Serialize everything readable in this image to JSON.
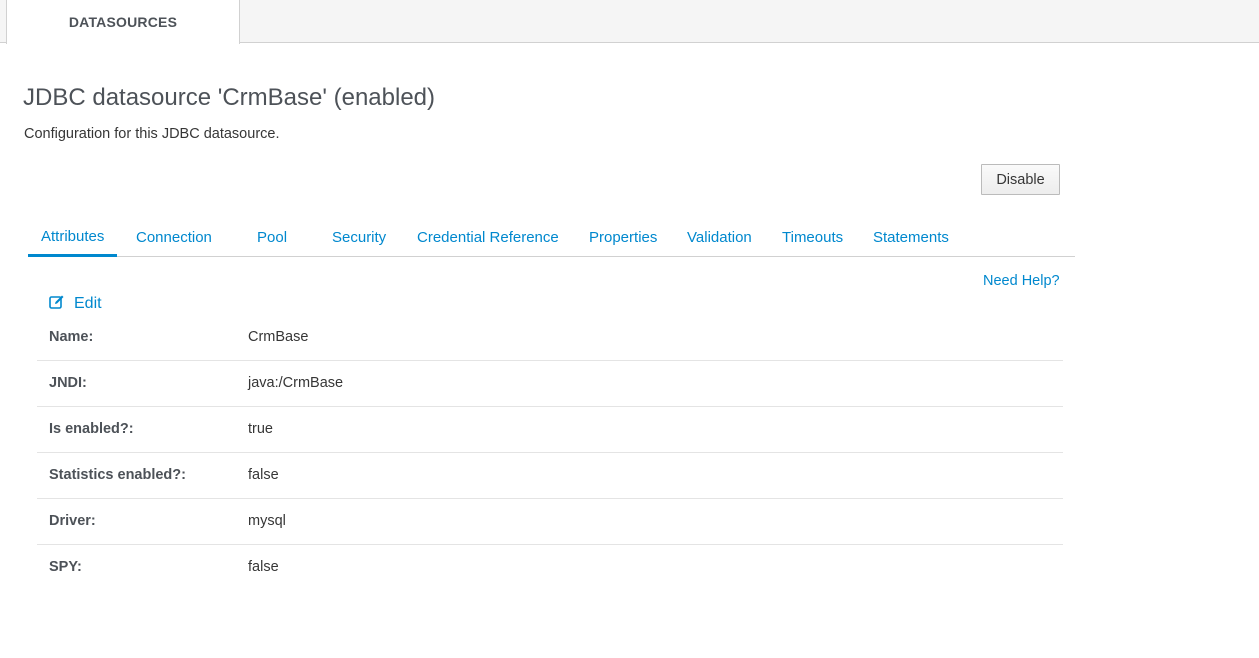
{
  "top_tab": "DATASOURCES",
  "page_title": "JDBC datasource 'CrmBase' (enabled)",
  "page_description": "Configuration for this JDBC datasource.",
  "disable_button": "Disable",
  "tabs": [
    {
      "label": "Attributes"
    },
    {
      "label": "Connection"
    },
    {
      "label": "Pool"
    },
    {
      "label": "Security"
    },
    {
      "label": "Credential Reference"
    },
    {
      "label": "Properties"
    },
    {
      "label": "Validation"
    },
    {
      "label": "Timeouts"
    },
    {
      "label": "Statements"
    }
  ],
  "need_help": "Need Help?",
  "edit_label": "Edit",
  "attributes": [
    {
      "label": "Name:",
      "value": "CrmBase"
    },
    {
      "label": "JNDI:",
      "value": "java:/CrmBase"
    },
    {
      "label": "Is enabled?:",
      "value": "true"
    },
    {
      "label": "Statistics enabled?:",
      "value": "false"
    },
    {
      "label": "Driver:",
      "value": "mysql"
    },
    {
      "label": "SPY:",
      "value": "false"
    }
  ],
  "colors": {
    "link": "#0088ce",
    "active_tab_underline": "#0088ce",
    "text": "#363636"
  },
  "icons": {
    "edit": "pencil-square-icon"
  }
}
